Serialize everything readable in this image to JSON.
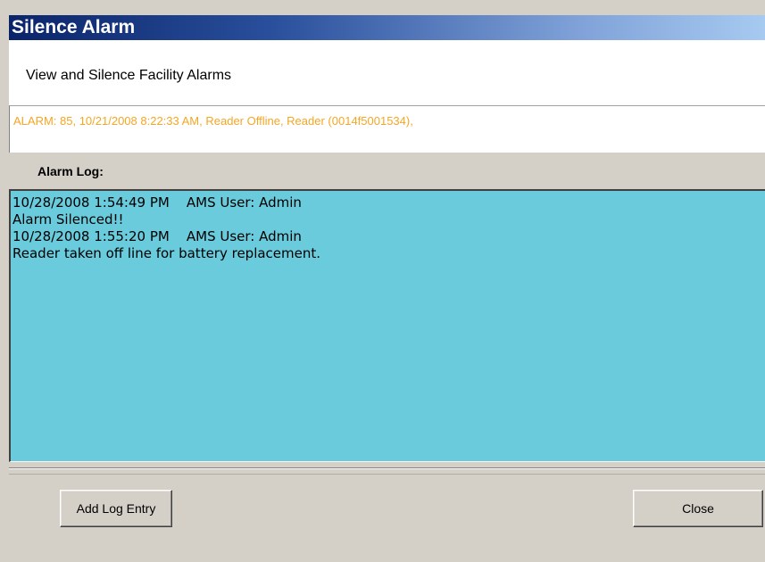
{
  "window": {
    "title": "Silence Alarm"
  },
  "header": {
    "subtitle": "View and Silence Facility Alarms"
  },
  "alarm": {
    "text": "ALARM: 85, 10/21/2008 8:22:33 AM, Reader Offline, Reader (0014f5001534),"
  },
  "log": {
    "label": "Alarm Log:",
    "lines": [
      "10/28/2008 1:54:49 PM    AMS User: Admin",
      "Alarm Silenced!!",
      "10/28/2008 1:55:20 PM    AMS User: Admin",
      "Reader taken off line for battery replacement."
    ]
  },
  "buttons": {
    "add_log_entry": "Add Log Entry",
    "close": "Close"
  },
  "colors": {
    "title_gradient_start": "#0a246a",
    "title_gradient_end": "#a6caf0",
    "alarm_text": "#f5a623",
    "log_background": "#69cbdb",
    "window_background": "#d4d0c8"
  }
}
